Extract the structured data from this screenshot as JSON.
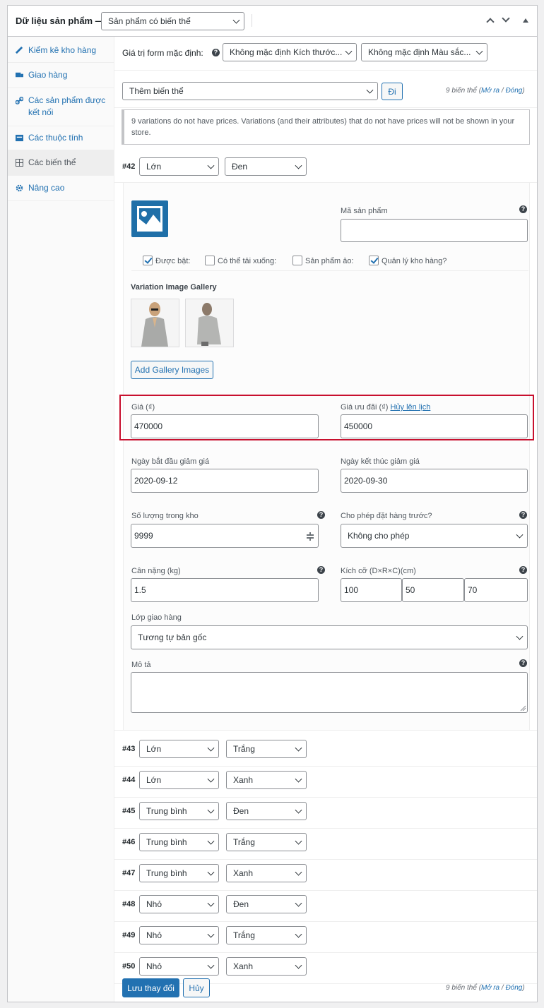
{
  "header": {
    "title": "Dữ liệu sản phẩm —",
    "product_type": "Sản phẩm có biến thể"
  },
  "sidebar": {
    "items": [
      {
        "label": "Kiểm kê kho hàng",
        "icon": "inventory-icon"
      },
      {
        "label": "Giao hàng",
        "icon": "truck-icon"
      },
      {
        "label": "Các sản phẩm được kết nối",
        "icon": "link-icon"
      },
      {
        "label": "Các thuộc tính",
        "icon": "attributes-icon"
      },
      {
        "label": "Các biến thể",
        "icon": "grid-icon"
      },
      {
        "label": "Nâng cao",
        "icon": "gear-icon"
      }
    ]
  },
  "defaults": {
    "label": "Giá trị form mặc định:",
    "size": "Không mặc định Kích thước...",
    "color": "Không mặc định Màu sắc..."
  },
  "bulk": {
    "action": "Thêm biến thể",
    "go": "Đi",
    "count_text": "9 biến thể",
    "expand": "Mở ra",
    "slash": "/",
    "collapse": "Đóng"
  },
  "notice": "9 variations do not have prices. Variations (and their attributes) that do not have prices will not be shown in your store.",
  "variation42": {
    "id": "#42",
    "size": "Lớn",
    "color": "Đen",
    "sku_label": "Mã sản phẩm",
    "sku_value": "",
    "enabled_label": "Được bật:",
    "downloadable_label": "Có thể tải xuống:",
    "virtual_label": "Sản phẩm ảo:",
    "manage_stock_label": "Quản lý kho hàng?",
    "gallery_title": "Variation Image Gallery",
    "gallery_button": "Add Gallery Images",
    "price_label": "Giá (₫)",
    "price": "470000",
    "sale_label": "Giá ưu đãi (₫)",
    "schedule_cancel": "Hủy lên lịch",
    "sale_price": "450000",
    "sale_start_label": "Ngày bắt đầu giảm giá",
    "sale_start": "2020-09-12",
    "sale_end_label": "Ngày kết thúc giảm giá",
    "sale_end": "2020-09-30",
    "stock_qty_label": "Số lượng trong kho",
    "stock_qty": "9999",
    "backorders_label": "Cho phép đặt hàng trước?",
    "backorders": "Không cho phép",
    "weight_label": "Cân nặng (kg)",
    "weight": "1.5",
    "dims_label": "Kích cỡ (D×R×C)(cm)",
    "length": "100",
    "width": "50",
    "height": "70",
    "shipping_class_label": "Lớp giao hàng",
    "shipping_class": "Tương tự bản gốc",
    "description_label": "Mô tả",
    "description": ""
  },
  "variations": [
    {
      "id": "#43",
      "size": "Lớn",
      "color": "Trắng"
    },
    {
      "id": "#44",
      "size": "Lớn",
      "color": "Xanh"
    },
    {
      "id": "#45",
      "size": "Trung bình",
      "color": "Đen"
    },
    {
      "id": "#46",
      "size": "Trung bình",
      "color": "Trắng"
    },
    {
      "id": "#47",
      "size": "Trung bình",
      "color": "Xanh"
    },
    {
      "id": "#48",
      "size": "Nhỏ",
      "color": "Đen"
    },
    {
      "id": "#49",
      "size": "Nhỏ",
      "color": "Trắng"
    },
    {
      "id": "#50",
      "size": "Nhỏ",
      "color": "Xanh"
    }
  ],
  "footer": {
    "save": "Lưu thay đổi",
    "cancel": "Hủy",
    "count_text": "9 biến thể",
    "expand": "Mở ra",
    "slash": "/",
    "collapse": "Đóng"
  },
  "colors": {
    "accent": "#2271b1",
    "highlight_border": "#c8102e",
    "text": "#1d2327"
  }
}
